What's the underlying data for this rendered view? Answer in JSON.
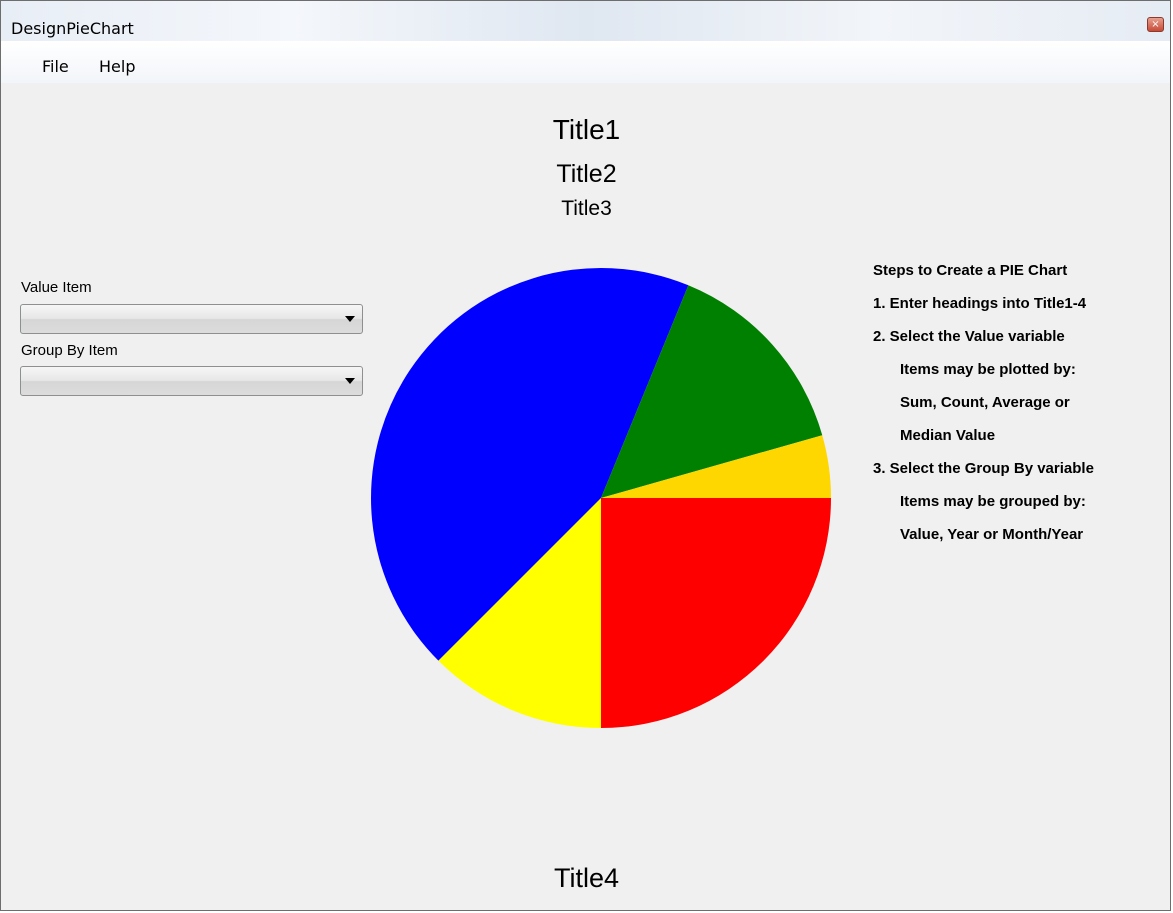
{
  "window": {
    "title": "DesignPieChart",
    "close_glyph": "×"
  },
  "menu": {
    "file": "File",
    "help": "Help"
  },
  "titles": {
    "title1": "Title1",
    "title2": "Title2",
    "title3": "Title3",
    "title4": "Title4"
  },
  "controls": {
    "value_item_label": "Value Item",
    "value_item_selected": "",
    "group_by_label": "Group By Item",
    "group_by_selected": ""
  },
  "steps": [
    "Steps to Create a PIE Chart",
    "1.  Enter headings into Title1-4",
    "2.  Select the Value variable",
    "Items may be plotted by:",
    "Sum, Count, Average or",
    "Median Value",
    "3.  Select the Group By variable",
    "Items may be grouped by:",
    "Value, Year or Month/Year"
  ],
  "chart_data": {
    "type": "pie",
    "start_angle_deg": 0,
    "direction": "clockwise",
    "slices": [
      {
        "value": 25.0,
        "color": "#ff0000"
      },
      {
        "value": 12.5,
        "color": "#ffff00"
      },
      {
        "value": 43.7,
        "color": "#0000ff"
      },
      {
        "value": 14.4,
        "color": "#008000"
      },
      {
        "value": 4.4,
        "color": "#ffd700"
      }
    ]
  }
}
